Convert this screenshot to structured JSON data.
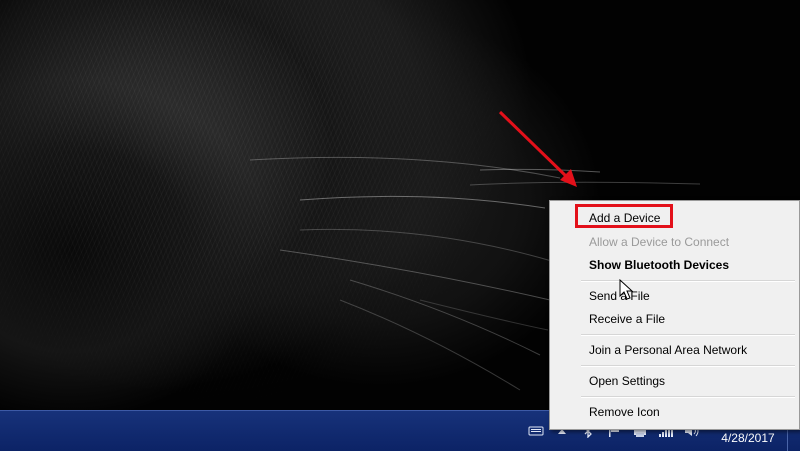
{
  "desktop": {
    "background": "black cat close-up wallpaper"
  },
  "annotation": {
    "arrow_color": "#e3101a",
    "highlight_color": "#e3101a"
  },
  "context_menu": {
    "items": [
      {
        "label": "Add a Device",
        "state": "highlighted"
      },
      {
        "label": "Allow a Device to Connect",
        "state": "disabled"
      },
      {
        "label": "Show Bluetooth Devices",
        "state": "default"
      },
      {
        "label": "Send a File",
        "state": "normal"
      },
      {
        "label": "Receive a File",
        "state": "normal"
      },
      {
        "label": "Join a Personal Area Network",
        "state": "normal"
      },
      {
        "label": "Open Settings",
        "state": "normal"
      },
      {
        "label": "Remove Icon",
        "state": "normal"
      }
    ]
  },
  "taskbar": {
    "color": "#17327a",
    "tray_icons": [
      "keyboard-icon",
      "show-hidden-icons-icon",
      "bluetooth-icon",
      "action-center-flag-icon",
      "printer-icon",
      "network-signal-icon",
      "volume-icon"
    ],
    "clock": {
      "date": "4/28/2017"
    }
  }
}
